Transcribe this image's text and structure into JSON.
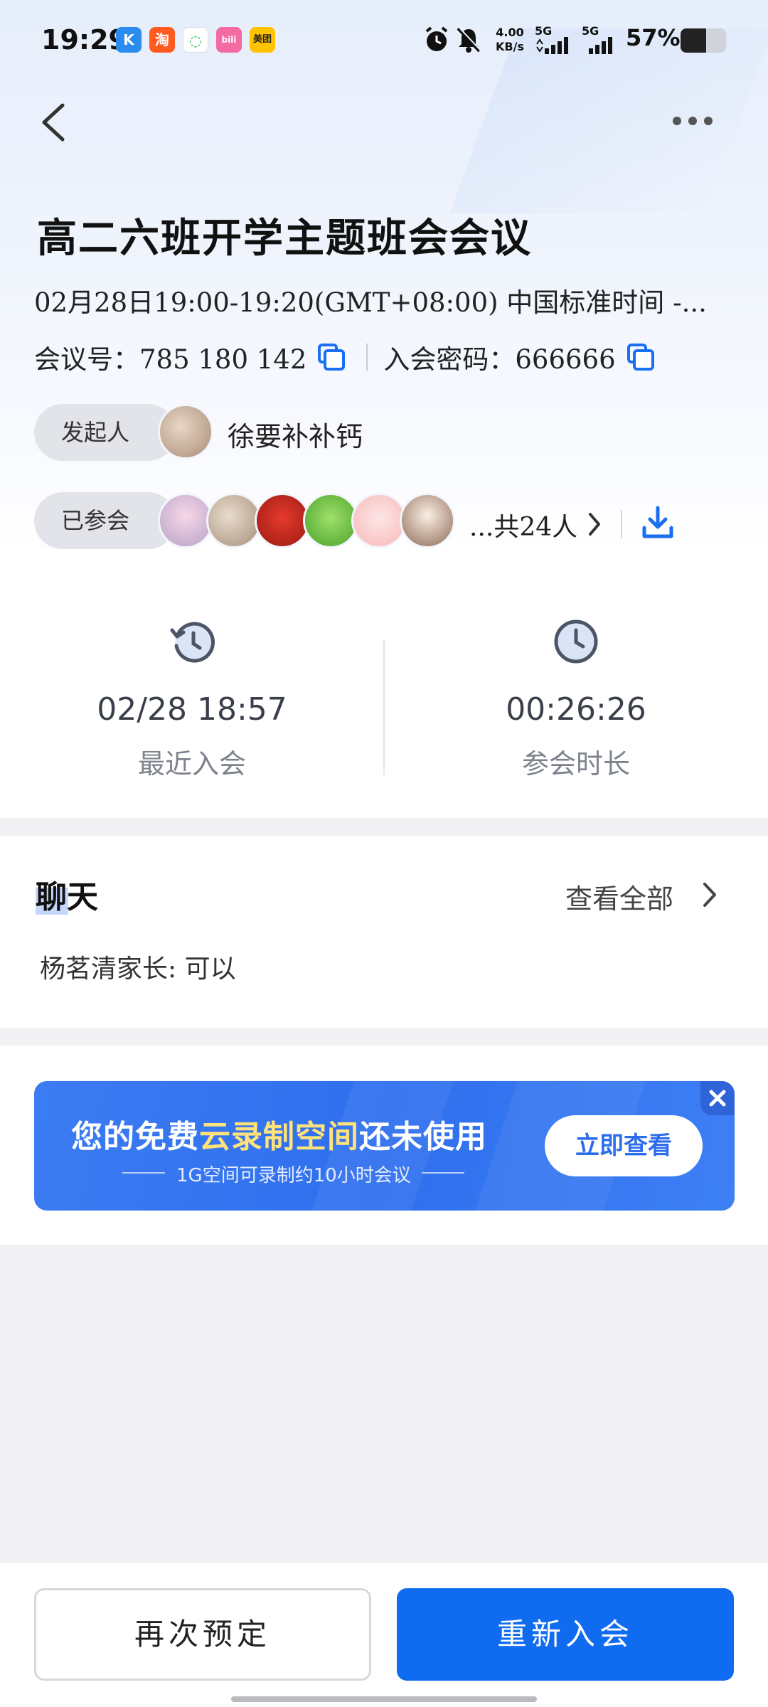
{
  "status_bar": {
    "time": "19:29",
    "apps": [
      {
        "icon": "kugou-icon",
        "glyph": "K",
        "color": "#2b8cf0"
      },
      {
        "icon": "taobao-icon",
        "glyph": "淘",
        "color": "#ff5a1f"
      },
      {
        "icon": "wechat-icon",
        "glyph": "◌",
        "color": "#ffffff"
      },
      {
        "icon": "bilibili-icon",
        "glyph": "bili",
        "color": "#f36ba2"
      },
      {
        "icon": "meituan-icon",
        "glyph": "美团",
        "color": "#ffc300"
      }
    ],
    "net_speed_value": "4.00",
    "net_speed_unit": "KB/s",
    "signal1": "5G",
    "signal2": "5G",
    "battery": "57%",
    "battery_level": 0.57
  },
  "meeting": {
    "title": "高二六班开学主题班会会议",
    "time_line": "02月28日19:00-19:20(GMT+08:00) 中国标准时间 -...",
    "id_label": "会议号：785 180 142",
    "password_label": "入会密码：666666",
    "organizer_label": "发起人",
    "organizer_name": "徐要补补钙",
    "attended_label": "已参会",
    "attendee_total": "...共24人"
  },
  "stats": {
    "recent_join_value": "02/28 18:57",
    "recent_join_label": "最近入会",
    "duration_value": "00:26:26",
    "duration_label": "参会时长"
  },
  "chat": {
    "title": "聊天",
    "view_all": "查看全部",
    "last_message": "杨茗清家长: 可以"
  },
  "banner": {
    "title_pre": "您的免费",
    "title_hl": "云录制空间",
    "title_post": "还未使用",
    "subtitle": "1G空间可录制约10小时会议",
    "button": "立即查看"
  },
  "bottom": {
    "reschedule": "再次预定",
    "rejoin": "重新入会"
  },
  "colors": {
    "primary": "#0f6bf0",
    "banner": "#3b7cf2",
    "banner_highlight": "#ffe27a"
  }
}
